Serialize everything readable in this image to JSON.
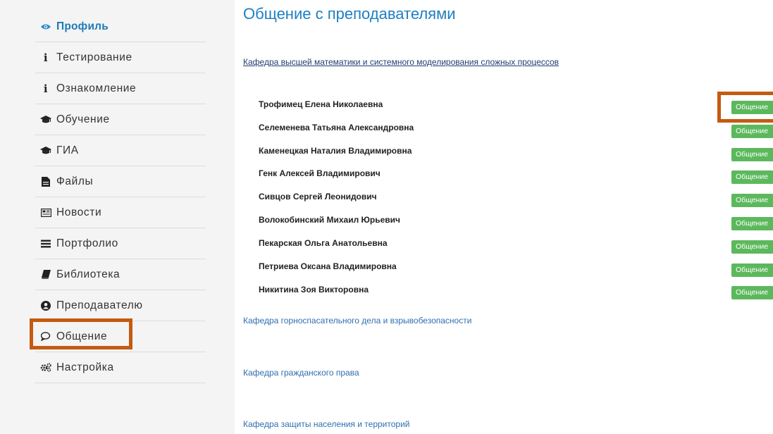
{
  "sidebar": {
    "items": [
      {
        "label": "Профиль",
        "icon": "eye-icon",
        "active": true
      },
      {
        "label": "Тестирование",
        "icon": "info-icon"
      },
      {
        "label": "Ознакомление",
        "icon": "info-icon"
      },
      {
        "label": "Обучение",
        "icon": "graduation-cap-icon"
      },
      {
        "label": "ГИА",
        "icon": "graduation-cap-icon"
      },
      {
        "label": "Файлы",
        "icon": "file-icon"
      },
      {
        "label": "Новости",
        "icon": "newspaper-icon"
      },
      {
        "label": "Портфолио",
        "icon": "list-icon"
      },
      {
        "label": "Библиотека",
        "icon": "book-icon"
      },
      {
        "label": "Преподавателю",
        "icon": "user-circle-icon"
      },
      {
        "label": "Общение",
        "icon": "comments-icon"
      },
      {
        "label": "Настройка",
        "icon": "gears-icon"
      }
    ]
  },
  "main": {
    "title": "Общение с преподавателями",
    "departments": [
      "Кафедра высшей математики и системного моделирования сложных процессов",
      "Кафедра горноспасательного дела и взрывобезопасности",
      "Кафедра гражданского права",
      "Кафедра защиты населения и территорий"
    ],
    "teachers": [
      "Трофимец Елена Николаевна",
      "Селеменева Татьяна Александровна",
      "Каменецкая Наталия Владимировна",
      "Генк Алексей Владимирович",
      "Сивцов Сергей Леонидович",
      "Волокобинский Михаил Юрьевич",
      "Пекарская Ольга Анатольевна",
      "Петриева Оксана Владимировна",
      "Никитина Зоя Викторовна"
    ],
    "chat_button_label": "Общение"
  },
  "colors": {
    "accent": "#1e7fc1",
    "button": "#5cb85c",
    "highlight": "#c55a11",
    "sidebar_bg": "#f4f4f4"
  }
}
